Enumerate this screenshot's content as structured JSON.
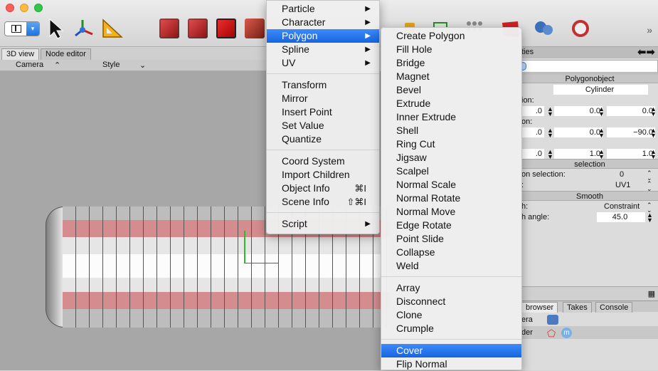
{
  "toolbar": {
    "icons": [
      "layout-icon",
      "arrow-cursor-icon",
      "move-icon",
      "set-square-icon",
      "points-mode-icon",
      "edges-mode-icon",
      "polygons-mode-icon",
      "object-mode-icon",
      "more-icon"
    ]
  },
  "viewport": {
    "tabs": [
      "3D view",
      "Node editor"
    ],
    "header": {
      "camera": "Camera",
      "style": "Style"
    }
  },
  "menu_main": {
    "items": [
      {
        "label": "Particle",
        "submenu": true
      },
      {
        "label": "Character",
        "submenu": true
      },
      {
        "label": "Polygon",
        "submenu": true,
        "highlighted": true
      },
      {
        "label": "Spline",
        "submenu": true
      },
      {
        "label": "UV",
        "submenu": true
      },
      {
        "label": "Transform"
      },
      {
        "label": "Mirror"
      },
      {
        "label": "Insert Point"
      },
      {
        "label": "Set Value"
      },
      {
        "label": "Quantize"
      },
      {
        "label": "Coord System"
      },
      {
        "label": "Import Children"
      },
      {
        "label": "Object Info",
        "shortcut": "⌘I"
      },
      {
        "label": "Scene Info",
        "shortcut": "⇧⌘I"
      },
      {
        "label": "Script",
        "submenu": true
      }
    ]
  },
  "menu_sub": {
    "items": [
      "Create Polygon",
      "Fill Hole",
      "Bridge",
      "Magnet",
      "Bevel",
      "Extrude",
      "Inner Extrude",
      "Shell",
      "Ring Cut",
      "Jigsaw",
      "Scalpel",
      "Normal Scale",
      "Normal Rotate",
      "Normal Move",
      "Edge Rotate",
      "Point Slide",
      "Collapse",
      "Weld",
      "Array",
      "Disconnect",
      "Clone",
      "Crumple",
      "Cover",
      "Flip Normal"
    ],
    "highlighted": "Cover"
  },
  "properties": {
    "header_title": "ties",
    "section_polygonobject": "Polygonobject",
    "object_name": "Cylinder",
    "label_position": "ion:",
    "label_rotation": "on:",
    "row1": [
      ".0",
      "0.0",
      "0.0"
    ],
    "row2": [
      ".0",
      "0.0",
      "−90.0"
    ],
    "row3": [
      ".0",
      "1.0",
      "1.0"
    ],
    "section_selection": "selection",
    "selection_label": "on selection:",
    "selection_value": "0",
    "uv_label": ":",
    "uv_value": "UV1",
    "section_smooth": "Smooth",
    "smooth_label": "h:",
    "smooth_value": "Constraint",
    "angle_label": "h angle:",
    "angle_value": "45.0"
  },
  "bottom_panel": {
    "tabs": [
      "browser",
      "Takes",
      "Console"
    ],
    "rows": [
      {
        "label": "era",
        "icon": "camera-icon"
      },
      {
        "label": "der",
        "icon": "polygon-icon"
      }
    ]
  },
  "colors": {
    "highlight": "#1565e0",
    "selected_polygons": "#d48c8e",
    "axis_y": "#2bbb2b",
    "axis_x": "#d43030"
  }
}
